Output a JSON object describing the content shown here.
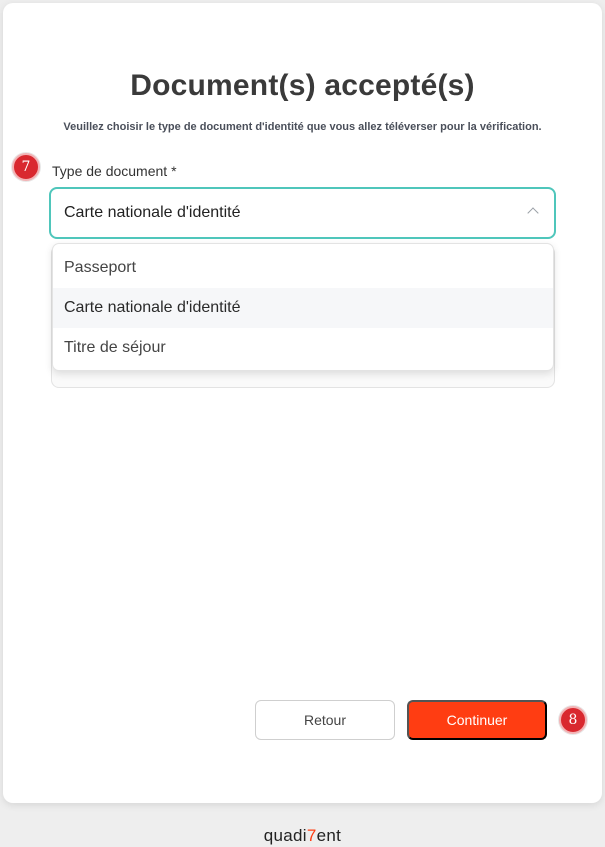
{
  "page": {
    "title": "Document(s) accepté(s)",
    "subtitle": "Veuillez choisir le type de document d'identité que vous allez téléverser pour la vérification."
  },
  "steps": {
    "field_step": "7",
    "continue_step": "8"
  },
  "form": {
    "document_type_label": "Type de document *",
    "selected_value": "Carte nationale d'identité",
    "options": [
      "Passeport",
      "Carte nationale d'identité",
      "Titre de séjour"
    ],
    "highlighted_option_index": 1
  },
  "actions": {
    "back_label": "Retour",
    "continue_label": "Continuer"
  },
  "brand": {
    "part1": "quadi",
    "accent": "7",
    "part2": "ent"
  },
  "colors": {
    "accent": "#ff3d12",
    "focus_border": "#4fc6bb",
    "step_badge": "#d9282f"
  },
  "icons": {
    "select_chevron": "chevron-up-icon"
  }
}
